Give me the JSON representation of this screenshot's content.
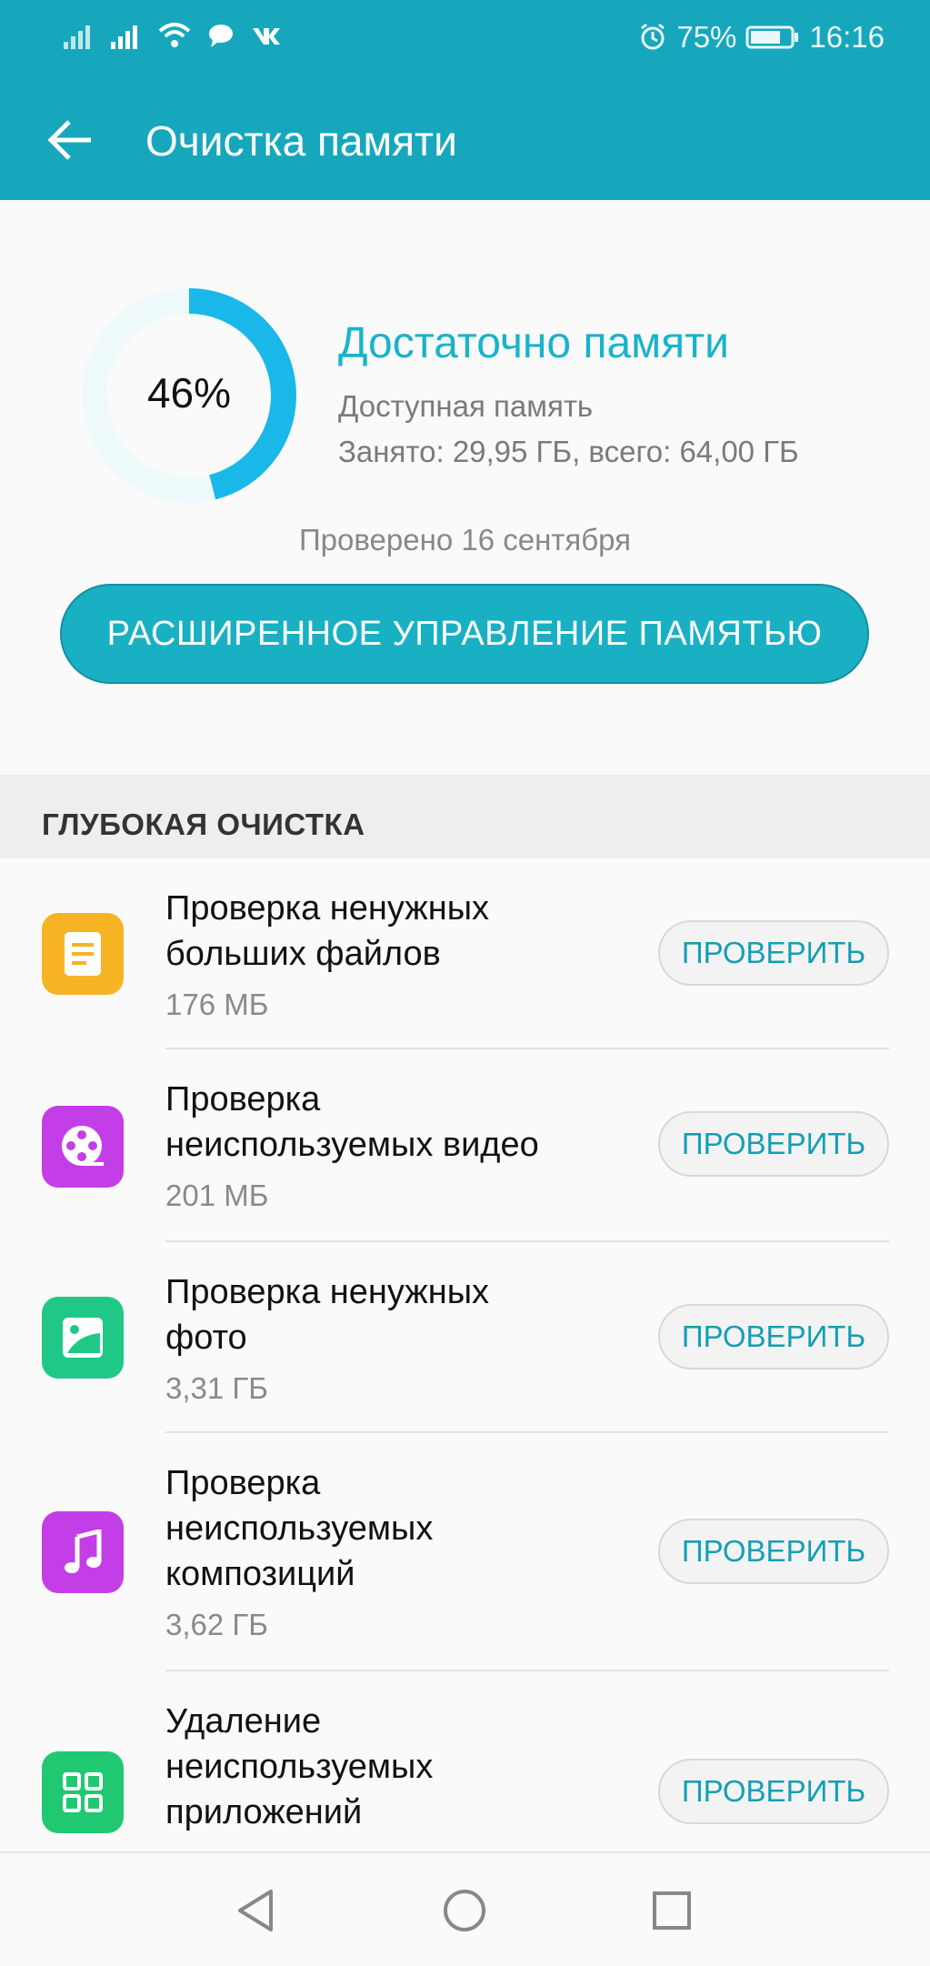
{
  "status": {
    "battery": "75%",
    "time": "16:16",
    "colors": {
      "bar": "#17a7bd"
    }
  },
  "header": {
    "title": "Очистка памяти",
    "back_icon": "arrow-left-icon"
  },
  "summary": {
    "percent_text": "46%",
    "used_fraction": 0.46,
    "status": "Достаточно памяти",
    "available_label": "Доступная память",
    "usage": "Занято: 29,95 ГБ, всего: 64,00 ГБ",
    "checked": "Проверено 16 сентября",
    "button": "РАСШИРЕННОЕ УПРАВЛЕНИЕ ПАМЯТЬЮ"
  },
  "section_title": "ГЛУБОКАЯ ОЧИСТКА",
  "items": [
    {
      "lines": [
        "Проверка ненужных",
        "больших файлов"
      ],
      "size": "176 МБ",
      "button": "ПРОВЕРИТЬ",
      "icon": "document-icon",
      "color": "#f6b324"
    },
    {
      "lines": [
        "Проверка",
        "неиспользуемых видео"
      ],
      "size": "201 МБ",
      "button": "ПРОВЕРИТЬ",
      "icon": "film-reel-icon",
      "color": "#c43ee8"
    },
    {
      "lines": [
        "Проверка ненужных",
        "фото"
      ],
      "size": "3,31 ГБ",
      "button": "ПРОВЕРИТЬ",
      "icon": "photo-icon",
      "color": "#1fc887"
    },
    {
      "lines": [
        "Проверка",
        "неиспользуемых",
        "композиций"
      ],
      "size": "3,62 ГБ",
      "button": "ПРОВЕРИТЬ",
      "icon": "music-note-icon",
      "color": "#c43ee8"
    },
    {
      "lines": [
        "Удаление",
        "неиспользуемых",
        "приложений"
      ],
      "size": "",
      "button": "ПРОВЕРИТЬ",
      "icon": "apps-grid-icon",
      "color": "#1fc871"
    }
  ]
}
